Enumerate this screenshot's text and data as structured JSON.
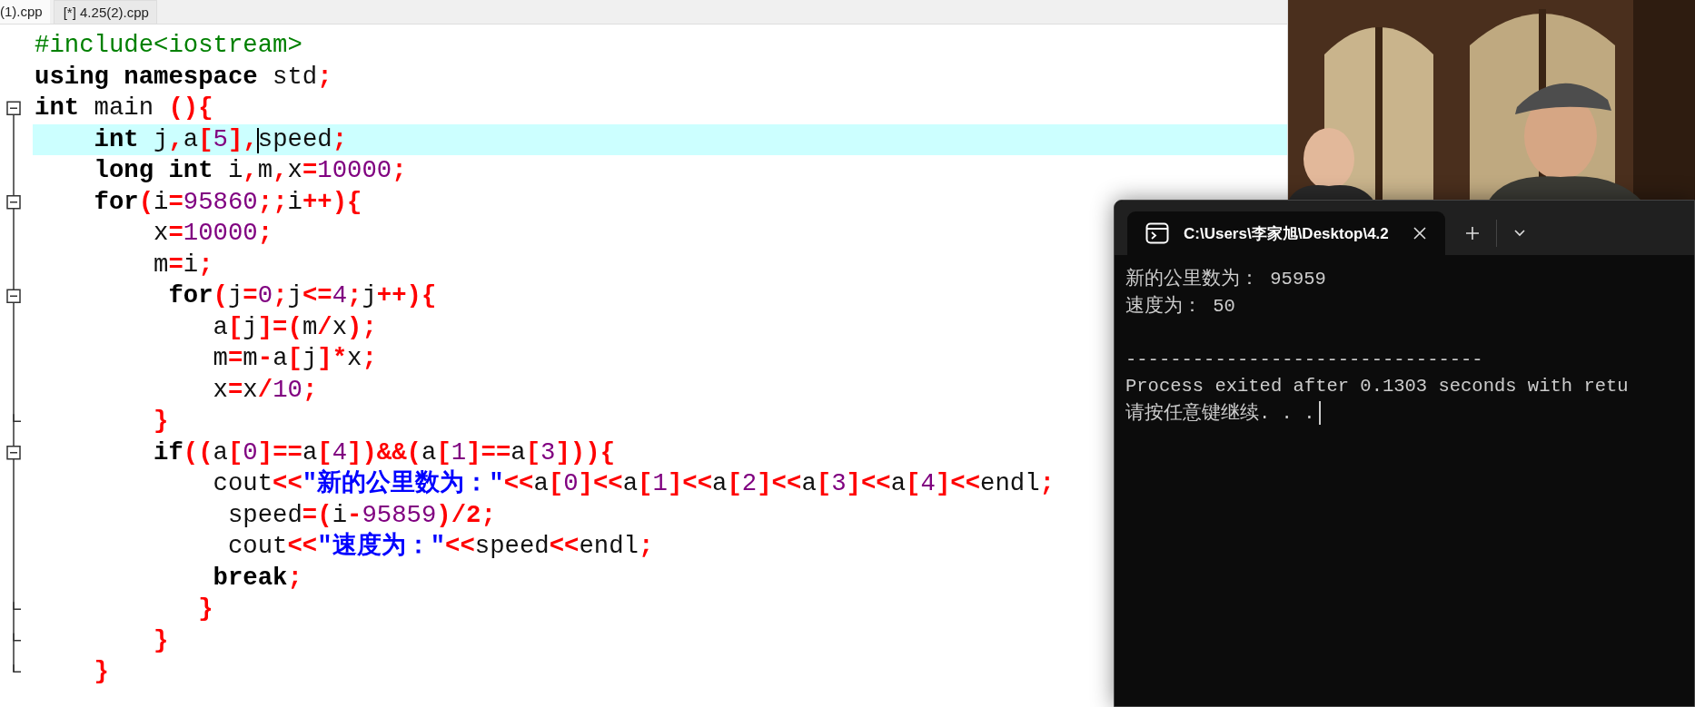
{
  "editor": {
    "tabs": [
      {
        "label": "(1).cpp",
        "selected": true
      },
      {
        "label": "[*] 4.25(2).cpp",
        "selected": false
      }
    ],
    "code_lines": [
      {
        "fold_start": false,
        "fold_end": false,
        "current": false,
        "segments": [
          {
            "kind": "pre",
            "text": "#include<iostream>"
          }
        ]
      },
      {
        "fold_start": false,
        "fold_end": false,
        "current": false,
        "segments": [
          {
            "kind": "kw",
            "text": "using namespace"
          },
          {
            "kind": "id",
            "text": " std"
          },
          {
            "kind": "sym",
            "text": ";"
          }
        ]
      },
      {
        "fold_start": true,
        "fold_end": false,
        "current": false,
        "segments": [
          {
            "kind": "kw",
            "text": "int"
          },
          {
            "kind": "id",
            "text": " main "
          },
          {
            "kind": "sym",
            "text": "(){"
          }
        ]
      },
      {
        "fold_start": false,
        "fold_end": false,
        "current": true,
        "segments": [
          {
            "kind": "kw",
            "text": "    int"
          },
          {
            "kind": "id",
            "text": " j"
          },
          {
            "kind": "sym",
            "text": ","
          },
          {
            "kind": "id",
            "text": "a"
          },
          {
            "kind": "sym",
            "text": "["
          },
          {
            "kind": "num",
            "text": "5"
          },
          {
            "kind": "sym",
            "text": "],"
          },
          {
            "kind": "id",
            "text": "speed",
            "caret": true
          },
          {
            "kind": "sym",
            "text": ";"
          }
        ]
      },
      {
        "fold_start": false,
        "fold_end": false,
        "current": false,
        "segments": [
          {
            "kind": "kw",
            "text": "    long int"
          },
          {
            "kind": "id",
            "text": " i"
          },
          {
            "kind": "sym",
            "text": ","
          },
          {
            "kind": "id",
            "text": "m"
          },
          {
            "kind": "sym",
            "text": ","
          },
          {
            "kind": "id",
            "text": "x"
          },
          {
            "kind": "sym",
            "text": "="
          },
          {
            "kind": "num",
            "text": "10000"
          },
          {
            "kind": "sym",
            "text": ";"
          }
        ]
      },
      {
        "fold_start": true,
        "fold_end": false,
        "current": false,
        "segments": [
          {
            "kind": "kw",
            "text": "    for"
          },
          {
            "kind": "sym",
            "text": "("
          },
          {
            "kind": "id",
            "text": "i"
          },
          {
            "kind": "sym",
            "text": "="
          },
          {
            "kind": "num",
            "text": "95860"
          },
          {
            "kind": "sym",
            "text": ";;"
          },
          {
            "kind": "id",
            "text": "i"
          },
          {
            "kind": "sym",
            "text": "++){"
          }
        ]
      },
      {
        "fold_start": false,
        "fold_end": false,
        "current": false,
        "segments": [
          {
            "kind": "id",
            "text": "        x"
          },
          {
            "kind": "sym",
            "text": "="
          },
          {
            "kind": "num",
            "text": "10000"
          },
          {
            "kind": "sym",
            "text": ";"
          }
        ]
      },
      {
        "fold_start": false,
        "fold_end": false,
        "current": false,
        "segments": [
          {
            "kind": "id",
            "text": "        m"
          },
          {
            "kind": "sym",
            "text": "="
          },
          {
            "kind": "id",
            "text": "i"
          },
          {
            "kind": "sym",
            "text": ";"
          }
        ]
      },
      {
        "fold_start": true,
        "fold_end": false,
        "current": false,
        "segments": [
          {
            "kind": "kw",
            "text": "         for"
          },
          {
            "kind": "sym",
            "text": "("
          },
          {
            "kind": "id",
            "text": "j"
          },
          {
            "kind": "sym",
            "text": "="
          },
          {
            "kind": "num",
            "text": "0"
          },
          {
            "kind": "sym",
            "text": ";"
          },
          {
            "kind": "id",
            "text": "j"
          },
          {
            "kind": "sym",
            "text": "<="
          },
          {
            "kind": "num",
            "text": "4"
          },
          {
            "kind": "sym",
            "text": ";"
          },
          {
            "kind": "id",
            "text": "j"
          },
          {
            "kind": "sym",
            "text": "++){"
          }
        ]
      },
      {
        "fold_start": false,
        "fold_end": false,
        "current": false,
        "segments": [
          {
            "kind": "id",
            "text": "            a"
          },
          {
            "kind": "sym",
            "text": "["
          },
          {
            "kind": "id",
            "text": "j"
          },
          {
            "kind": "sym",
            "text": "]=("
          },
          {
            "kind": "id",
            "text": "m"
          },
          {
            "kind": "sym",
            "text": "/"
          },
          {
            "kind": "id",
            "text": "x"
          },
          {
            "kind": "sym",
            "text": ");"
          }
        ]
      },
      {
        "fold_start": false,
        "fold_end": false,
        "current": false,
        "segments": [
          {
            "kind": "id",
            "text": "            m"
          },
          {
            "kind": "sym",
            "text": "="
          },
          {
            "kind": "id",
            "text": "m"
          },
          {
            "kind": "sym",
            "text": "-"
          },
          {
            "kind": "id",
            "text": "a"
          },
          {
            "kind": "sym",
            "text": "["
          },
          {
            "kind": "id",
            "text": "j"
          },
          {
            "kind": "sym",
            "text": "]*"
          },
          {
            "kind": "id",
            "text": "x"
          },
          {
            "kind": "sym",
            "text": ";"
          }
        ]
      },
      {
        "fold_start": false,
        "fold_end": false,
        "current": false,
        "segments": [
          {
            "kind": "id",
            "text": "            x"
          },
          {
            "kind": "sym",
            "text": "="
          },
          {
            "kind": "id",
            "text": "x"
          },
          {
            "kind": "sym",
            "text": "/"
          },
          {
            "kind": "num",
            "text": "10"
          },
          {
            "kind": "sym",
            "text": ";"
          }
        ]
      },
      {
        "fold_start": false,
        "fold_end": true,
        "current": false,
        "segments": [
          {
            "kind": "sym",
            "text": "        }"
          }
        ]
      },
      {
        "fold_start": true,
        "fold_end": false,
        "current": false,
        "segments": [
          {
            "kind": "kw",
            "text": "        if"
          },
          {
            "kind": "sym",
            "text": "(("
          },
          {
            "kind": "id",
            "text": "a"
          },
          {
            "kind": "sym",
            "text": "["
          },
          {
            "kind": "num",
            "text": "0"
          },
          {
            "kind": "sym",
            "text": "]=="
          },
          {
            "kind": "id",
            "text": "a"
          },
          {
            "kind": "sym",
            "text": "["
          },
          {
            "kind": "num",
            "text": "4"
          },
          {
            "kind": "sym",
            "text": "])&&("
          },
          {
            "kind": "id",
            "text": "a"
          },
          {
            "kind": "sym",
            "text": "["
          },
          {
            "kind": "num",
            "text": "1"
          },
          {
            "kind": "sym",
            "text": "]=="
          },
          {
            "kind": "id",
            "text": "a"
          },
          {
            "kind": "sym",
            "text": "["
          },
          {
            "kind": "num",
            "text": "3"
          },
          {
            "kind": "sym",
            "text": "])){"
          }
        ]
      },
      {
        "fold_start": false,
        "fold_end": false,
        "current": false,
        "segments": [
          {
            "kind": "id",
            "text": "            cout"
          },
          {
            "kind": "sym",
            "text": "<<"
          },
          {
            "kind": "str",
            "text": "\"新的公里数为：\""
          },
          {
            "kind": "sym",
            "text": "<<"
          },
          {
            "kind": "id",
            "text": "a"
          },
          {
            "kind": "sym",
            "text": "["
          },
          {
            "kind": "num",
            "text": "0"
          },
          {
            "kind": "sym",
            "text": "]<<"
          },
          {
            "kind": "id",
            "text": "a"
          },
          {
            "kind": "sym",
            "text": "["
          },
          {
            "kind": "num",
            "text": "1"
          },
          {
            "kind": "sym",
            "text": "]<<"
          },
          {
            "kind": "id",
            "text": "a"
          },
          {
            "kind": "sym",
            "text": "["
          },
          {
            "kind": "num",
            "text": "2"
          },
          {
            "kind": "sym",
            "text": "]<<"
          },
          {
            "kind": "id",
            "text": "a"
          },
          {
            "kind": "sym",
            "text": "["
          },
          {
            "kind": "num",
            "text": "3"
          },
          {
            "kind": "sym",
            "text": "]<<"
          },
          {
            "kind": "id",
            "text": "a"
          },
          {
            "kind": "sym",
            "text": "["
          },
          {
            "kind": "num",
            "text": "4"
          },
          {
            "kind": "sym",
            "text": "]<<"
          },
          {
            "kind": "id",
            "text": "endl"
          },
          {
            "kind": "sym",
            "text": ";"
          }
        ]
      },
      {
        "fold_start": false,
        "fold_end": false,
        "current": false,
        "segments": [
          {
            "kind": "id",
            "text": "             speed"
          },
          {
            "kind": "sym",
            "text": "=("
          },
          {
            "kind": "id",
            "text": "i"
          },
          {
            "kind": "sym",
            "text": "-"
          },
          {
            "kind": "num",
            "text": "95859"
          },
          {
            "kind": "sym",
            "text": ")/2;"
          }
        ]
      },
      {
        "fold_start": false,
        "fold_end": false,
        "current": false,
        "segments": [
          {
            "kind": "id",
            "text": "             cout"
          },
          {
            "kind": "sym",
            "text": "<<"
          },
          {
            "kind": "str",
            "text": "\"速度为：\""
          },
          {
            "kind": "sym",
            "text": "<<"
          },
          {
            "kind": "id",
            "text": "speed"
          },
          {
            "kind": "sym",
            "text": "<<"
          },
          {
            "kind": "id",
            "text": "endl"
          },
          {
            "kind": "sym",
            "text": ";"
          }
        ]
      },
      {
        "fold_start": false,
        "fold_end": false,
        "current": false,
        "segments": [
          {
            "kind": "kw",
            "text": "            break"
          },
          {
            "kind": "sym",
            "text": ";"
          }
        ]
      },
      {
        "fold_start": false,
        "fold_end": true,
        "current": false,
        "segments": [
          {
            "kind": "sym",
            "text": "           }"
          }
        ]
      },
      {
        "fold_start": false,
        "fold_end": true,
        "current": false,
        "segments": [
          {
            "kind": "sym",
            "text": "        }"
          }
        ]
      },
      {
        "fold_start": false,
        "fold_end": true,
        "current": false,
        "segments": [
          {
            "kind": "sym",
            "text": "    }"
          }
        ]
      }
    ]
  },
  "terminal": {
    "title": "C:\\Users\\李家旭\\Desktop\\4.2",
    "lines": [
      {
        "text": "新的公里数为： 95959",
        "gap_before": false,
        "caret": false
      },
      {
        "text": "速度为： 50",
        "gap_before": false,
        "caret": false
      },
      {
        "text": "--------------------------------",
        "gap_before": true,
        "caret": false
      },
      {
        "text": "Process exited after 0.1303 seconds with retu",
        "gap_before": false,
        "caret": false
      },
      {
        "text": "请按任意键继续. . .",
        "gap_before": false,
        "caret": true
      }
    ]
  }
}
